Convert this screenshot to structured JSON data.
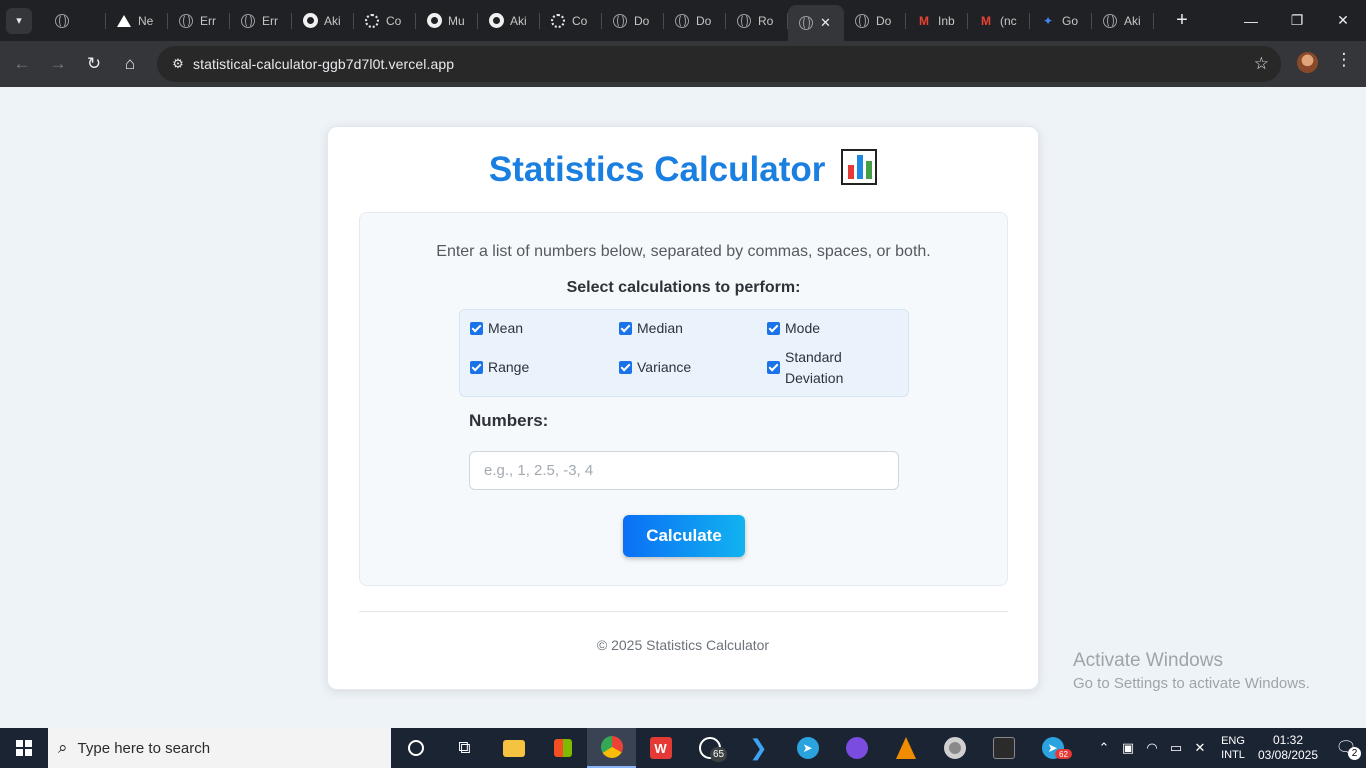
{
  "browser": {
    "tabs": [
      {
        "label": "",
        "icon": "globe-icon"
      },
      {
        "label": "Ne",
        "icon": "triangle-icon"
      },
      {
        "label": "Err",
        "icon": "globe-icon"
      },
      {
        "label": "Err",
        "icon": "globe-icon"
      },
      {
        "label": "Aki",
        "icon": "github-icon"
      },
      {
        "label": "Co",
        "icon": "openai-icon"
      },
      {
        "label": "Mu",
        "icon": "github-icon"
      },
      {
        "label": "Aki",
        "icon": "github-icon"
      },
      {
        "label": "Co",
        "icon": "openai-icon"
      },
      {
        "label": "Do",
        "icon": "globe-icon"
      },
      {
        "label": "Do",
        "icon": "globe-icon"
      },
      {
        "label": "Ro",
        "icon": "globe-icon"
      },
      {
        "label": "",
        "icon": "globe-icon",
        "active": true
      },
      {
        "label": "Do",
        "icon": "globe-icon"
      },
      {
        "label": "Inb",
        "icon": "gmail-icon"
      },
      {
        "label": "(nc",
        "icon": "gmail-icon"
      },
      {
        "label": "Go",
        "icon": "gemini-icon"
      },
      {
        "label": "Aki",
        "icon": "globe-icon"
      }
    ],
    "url": "statistical-calculator-ggb7d7l0t.vercel.app"
  },
  "page": {
    "title": "Statistics Calculator",
    "intro": "Enter a list of numbers below, separated by commas, spaces, or both.",
    "select_title": "Select calculations to perform:",
    "options": [
      {
        "label": "Mean",
        "checked": true
      },
      {
        "label": "Median",
        "checked": true
      },
      {
        "label": "Mode",
        "checked": true
      },
      {
        "label": "Range",
        "checked": true
      },
      {
        "label": "Variance",
        "checked": true
      },
      {
        "label": "Standard Deviation",
        "checked": true
      }
    ],
    "numbers_label": "Numbers:",
    "numbers_value": "",
    "numbers_placeholder": "e.g., 1, 2.5, -3, 4",
    "calculate_label": "Calculate",
    "footer": "© 2025 Statistics Calculator"
  },
  "watermark": {
    "line1": "Activate Windows",
    "line2": "Go to Settings to activate Windows."
  },
  "taskbar": {
    "search_placeholder": "Type here to search",
    "whatsapp_badge": "65",
    "telegram_badge": "62",
    "lang_line1": "ENG",
    "lang_line2": "INTL",
    "time": "01:32",
    "date": "03/08/2025",
    "notifications": "2"
  },
  "colors": {
    "accent": "#1a7fe0",
    "button_start": "#0b6ff5",
    "button_end": "#11b3f0",
    "checkbox": "#1a73e8"
  }
}
